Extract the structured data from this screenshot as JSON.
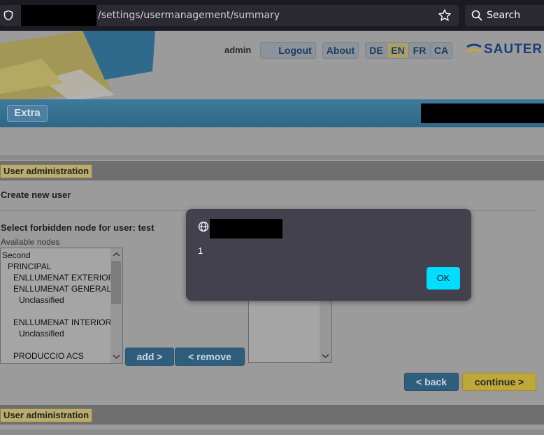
{
  "browser": {
    "url_text": "/settings/usermanagement/summary",
    "search_label": "Search"
  },
  "header": {
    "user": "admin",
    "logout": "Logout",
    "about": "About",
    "languages": [
      "DE",
      "EN",
      "FR",
      "CA"
    ],
    "active_language": "EN",
    "brand": "SAUTER"
  },
  "extra_button": "Extra",
  "section_label": "User administration",
  "create_title": "Create new user",
  "forbidden_label": "Select forbidden node for user:  test",
  "available_label": "Available nodes",
  "available_nodes": [
    "Second",
    "PRINCIPAL",
    "ENLLUMENAT EXTERIOR",
    "ENLLUMENAT GENERAL",
    "Unclassified",
    "",
    "ENLLUMENAT INTERIOR",
    "Unclassified",
    "",
    "PRODUCCIO ACS"
  ],
  "buttons": {
    "add": "add >",
    "remove": "< remove",
    "back": "< back",
    "continue": "continue >"
  },
  "dialog": {
    "message": "1",
    "ok": "OK"
  },
  "colors": {
    "dialog_bg": "#42414d",
    "ok_button": "#00ddff",
    "section_label_bg": "#b9ac6e"
  }
}
